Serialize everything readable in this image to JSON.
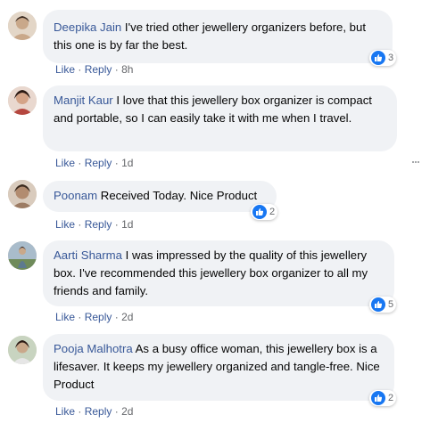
{
  "comments": [
    {
      "author": "Deepika Jain",
      "text": " I've tried other jewellery organizers before, but this one is by far the best.",
      "like": "Like",
      "reply": "Reply",
      "time": "8h",
      "reactions": "3",
      "avatar_color": "#c9a88a"
    },
    {
      "author": "Manjit Kaur",
      "text": " I love that this jewellery box organizer is compact and portable, so I can easily take it with me when I travel.",
      "like": "Like",
      "reply": "Reply",
      "time": "1d",
      "reactions": "",
      "avatar_color": "#b5473f"
    },
    {
      "author": "Poonam",
      "text": " Received Today. Nice Product",
      "like": "Like",
      "reply": "Reply",
      "time": "1d",
      "reactions": "2",
      "avatar_color": "#9c7b63"
    },
    {
      "author": "Aarti Sharma",
      "text": " I was impressed by the quality of this jewellery box. I've recommended this jewellery box organizer to all my friends and family.",
      "like": "Like",
      "reply": "Reply",
      "time": "2d",
      "reactions": "5",
      "avatar_color": "#5d7a8f"
    },
    {
      "author": "Pooja Malhotra",
      "text": " As a busy office woman, this jewellery box is a lifesaver. It keeps my jewellery organized and tangle-free. Nice Product",
      "like": "Like",
      "reply": "Reply",
      "time": "2d",
      "reactions": "2",
      "avatar_color": "#7a8f6a"
    }
  ],
  "separator": "·",
  "accent_color": "#385898",
  "reaction_color": "#1877f2"
}
